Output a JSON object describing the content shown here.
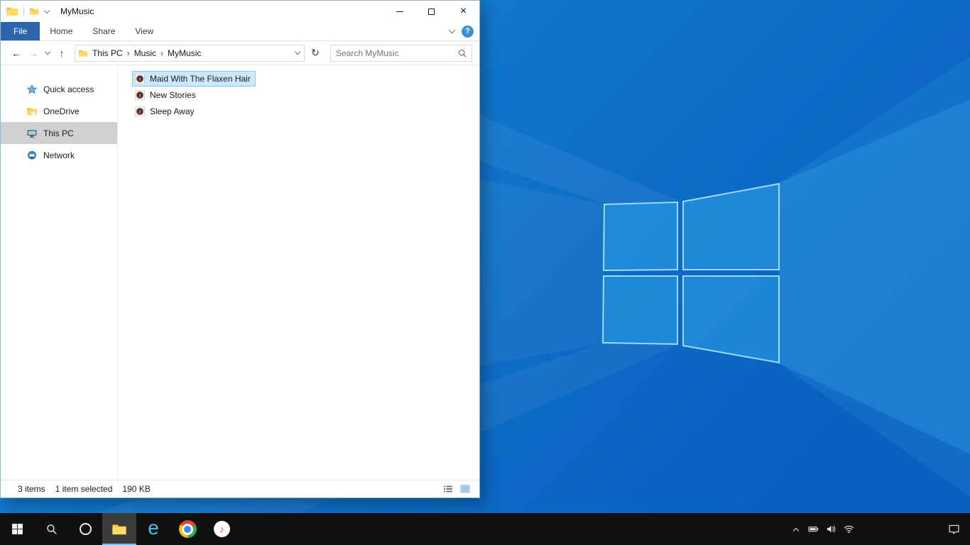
{
  "window": {
    "title": "MyMusic",
    "titlebar_icons": [
      "folder-icon",
      "folder-small-icon",
      "chevron-down-icon"
    ],
    "controls": [
      "minimize",
      "maximize",
      "close"
    ],
    "ribbon": {
      "tabs": [
        {
          "label": "File",
          "active": true
        },
        {
          "label": "Home",
          "active": false
        },
        {
          "label": "Share",
          "active": false
        },
        {
          "label": "View",
          "active": false
        }
      ],
      "collapse_icon": "chevron-down-icon",
      "help_label": "?"
    },
    "navigation": {
      "back": "←",
      "forward": "→",
      "up": "↑",
      "refresh": "↻"
    },
    "address": {
      "path": [
        {
          "label": "This PC"
        },
        {
          "label": "Music"
        },
        {
          "label": "MyMusic"
        }
      ],
      "separator": "›"
    },
    "search": {
      "placeholder": "Search MyMusic"
    },
    "sidebar": {
      "items": [
        {
          "label": "Quick access",
          "icon": "star-icon",
          "selected": false
        },
        {
          "label": "OneDrive",
          "icon": "onedrive-folder-icon",
          "selected": false
        },
        {
          "label": "This PC",
          "icon": "monitor-icon",
          "selected": true
        },
        {
          "label": "Network",
          "icon": "network-icon",
          "selected": false
        }
      ]
    },
    "files": [
      {
        "name": "Maid With The Flaxen Hair",
        "icon": "music-file-icon",
        "selected": true
      },
      {
        "name": "New Stories",
        "icon": "music-file-icon",
        "selected": false
      },
      {
        "name": "Sleep Away",
        "icon": "music-file-icon",
        "selected": false
      }
    ],
    "status": {
      "count": "3 items",
      "selection": "1 item selected",
      "size": "190 KB"
    },
    "view_toggles": [
      "details-view-icon",
      "thumbnail-view-icon"
    ]
  },
  "taskbar": {
    "icons": [
      "start",
      "search",
      "cortana",
      "file-explorer",
      "internet-explorer",
      "chrome",
      "itunes"
    ],
    "active_icon": "file-explorer",
    "ie_glyph": "e",
    "tray": [
      "chevron-up",
      "battery",
      "volume",
      "network-wifi"
    ],
    "action_center": "action-center"
  },
  "colors": {
    "selection_bg": "#cce8ff",
    "selection_border": "#8fc6f3",
    "nav_selected_bg": "#d0d0d0",
    "file_tab_blue": "#2a65ad",
    "help_blue": "#3f92d2",
    "taskbar_bg": "#101010",
    "taskbar_active_underline": "#76b9ed",
    "wallpaper_blue": "#0f75cc",
    "logo_blue": "#31a8e8",
    "folder_yellow": "#ffd968"
  }
}
